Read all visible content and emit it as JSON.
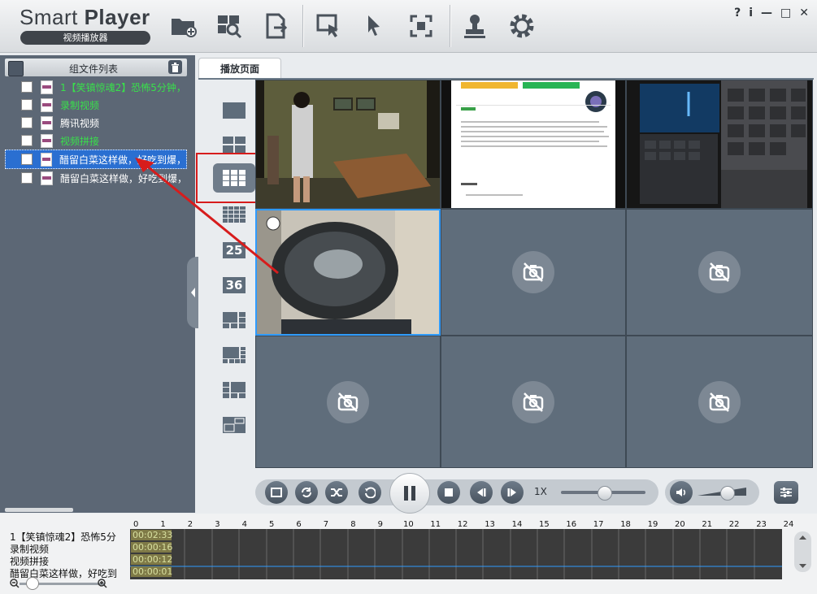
{
  "app": {
    "title_light": "Smart ",
    "title_bold": "Player",
    "subtitle": "视频播放器",
    "window_controls": [
      "?",
      "i",
      "—",
      "□",
      "✕"
    ]
  },
  "toolbar": {
    "icons": [
      "folder-add-icon",
      "search-file-icon",
      "export-icon",
      "select-area-icon",
      "cursor-icon",
      "fullscreen-icon",
      "stamp-icon",
      "gear-icon"
    ]
  },
  "file_panel": {
    "title": "组文件列表",
    "items": [
      {
        "name": "1【笑镇惊魂2】恐怖5分钟，",
        "color": "#39e04b"
      },
      {
        "name": "录制视频",
        "color": "#39e04b"
      },
      {
        "name": "腾讯视频",
        "color": "#ffffff"
      },
      {
        "name": "视频拼接",
        "color": "#39e04b"
      },
      {
        "name": "醋留白菜这样做，好吃到爆，",
        "color": "#ffffff",
        "selected": true
      },
      {
        "name": "醋留白菜这样做，好吃到爆，",
        "color": "#ffffff"
      }
    ]
  },
  "play_tab": {
    "label": "播放页面"
  },
  "layout_buttons": {
    "labels_25": "25",
    "labels_36": "36"
  },
  "controls": {
    "speed": "1X",
    "speed_level": 0.5,
    "volume_level": 0.55
  },
  "timeline": {
    "hours": [
      "0",
      "1",
      "2",
      "3",
      "4",
      "5",
      "6",
      "7",
      "8",
      "9",
      "10",
      "11",
      "12",
      "13",
      "14",
      "15",
      "16",
      "17",
      "18",
      "19",
      "20",
      "21",
      "22",
      "23",
      "24"
    ],
    "rows": [
      {
        "name": "1【笑镇惊魂2】恐怖5分",
        "time": "00:02:33"
      },
      {
        "name": "录制视频",
        "time": "00:00:16"
      },
      {
        "name": "视频拼接",
        "time": "00:00:12"
      },
      {
        "name": "醋留白菜这样做，好吃到",
        "time": "00:00:01"
      }
    ]
  },
  "accent_colors": {
    "highlight": "#d71c1c",
    "selection": "#2a6fd1",
    "active_cell": "#2f9bff"
  }
}
